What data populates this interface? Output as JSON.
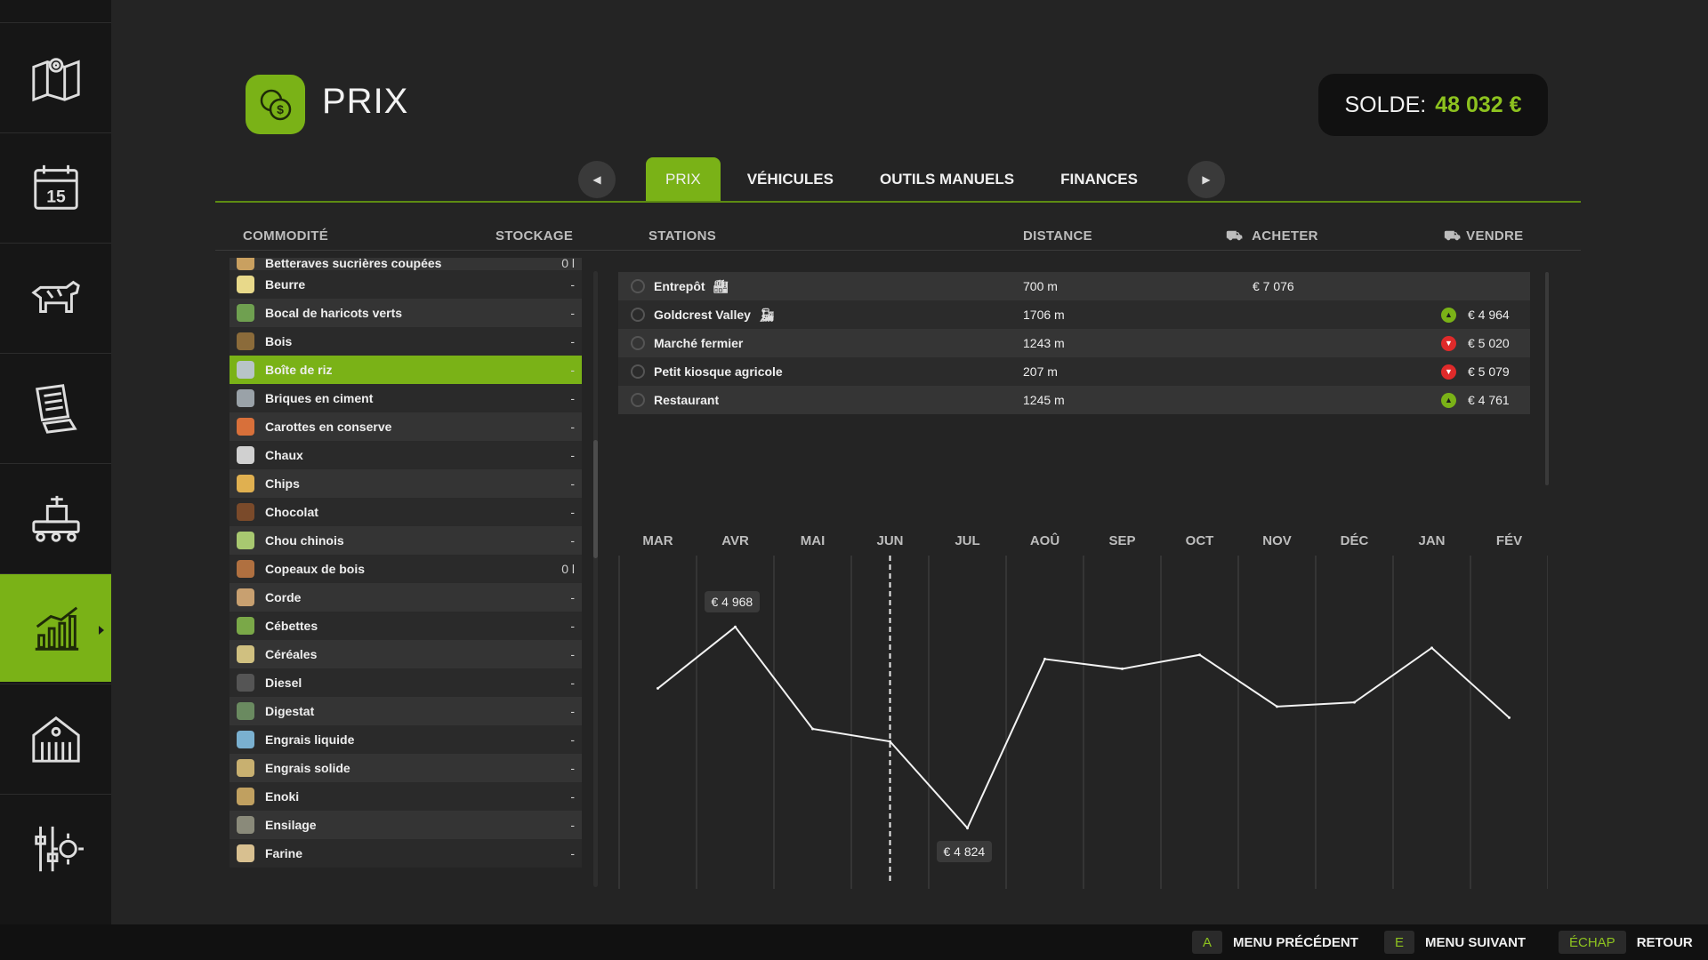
{
  "header": {
    "title": "PRIX",
    "balance_label": "SOLDE:",
    "balance_value": "48 032 €"
  },
  "sidebar": {
    "items": [
      {
        "name": "map-icon"
      },
      {
        "name": "calendar-icon",
        "day": "15"
      },
      {
        "name": "cow-icon"
      },
      {
        "name": "contracts-icon"
      },
      {
        "name": "production-icon"
      },
      {
        "name": "prices-chart-icon"
      },
      {
        "name": "barn-icon"
      },
      {
        "name": "settings-icon"
      }
    ]
  },
  "tabs": [
    "PRIX",
    "VÉHICULES",
    "OUTILS MANUELS",
    "FINANCES"
  ],
  "columns": {
    "commodity": "COMMODITÉ",
    "storage": "STOCKAGE",
    "stations": "STATIONS",
    "distance": "DISTANCE",
    "buy": "ACHETER",
    "sell": "VENDRE"
  },
  "commodities": [
    {
      "name": "Betteraves sucrières coupées",
      "stock": "0 l",
      "partial": true
    },
    {
      "name": "Beurre",
      "stock": "-"
    },
    {
      "name": "Bocal de haricots verts",
      "stock": "-"
    },
    {
      "name": "Bois",
      "stock": "-"
    },
    {
      "name": "Boîte de riz",
      "stock": "-",
      "selected": true
    },
    {
      "name": "Briques en ciment",
      "stock": "-"
    },
    {
      "name": "Carottes en conserve",
      "stock": "-"
    },
    {
      "name": "Chaux",
      "stock": "-"
    },
    {
      "name": "Chips",
      "stock": "-"
    },
    {
      "name": "Chocolat",
      "stock": "-"
    },
    {
      "name": "Chou chinois",
      "stock": "-"
    },
    {
      "name": "Copeaux de bois",
      "stock": "0 l"
    },
    {
      "name": "Corde",
      "stock": "-"
    },
    {
      "name": "Cébettes",
      "stock": "-"
    },
    {
      "name": "Céréales",
      "stock": "-"
    },
    {
      "name": "Diesel",
      "stock": "-"
    },
    {
      "name": "Digestat",
      "stock": "-"
    },
    {
      "name": "Engrais liquide",
      "stock": "-"
    },
    {
      "name": "Engrais solide",
      "stock": "-"
    },
    {
      "name": "Enoki",
      "stock": "-"
    },
    {
      "name": "Ensilage",
      "stock": "-"
    },
    {
      "name": "Farine",
      "stock": "-"
    }
  ],
  "stations": [
    {
      "name": "Entrepôt",
      "badge": "factory-icon",
      "distance": "700 m",
      "buy": "€ 7 076",
      "sell": "",
      "trend": ""
    },
    {
      "name": "Goldcrest Valley",
      "badge": "train-icon",
      "distance": "1706 m",
      "buy": "",
      "sell": "€ 4 964",
      "trend": "up"
    },
    {
      "name": "Marché fermier",
      "badge": "",
      "distance": "1243 m",
      "buy": "",
      "sell": "€ 5 020",
      "trend": "down"
    },
    {
      "name": "Petit kiosque agricole",
      "badge": "",
      "distance": "207 m",
      "buy": "",
      "sell": "€ 5 079",
      "trend": "down"
    },
    {
      "name": "Restaurant",
      "badge": "",
      "distance": "1245 m",
      "buy": "",
      "sell": "€ 4 761",
      "trend": "up"
    }
  ],
  "chart_data": {
    "type": "line",
    "categories": [
      "MAR",
      "AVR",
      "MAI",
      "JUN",
      "JUL",
      "AOÛ",
      "SEP",
      "OCT",
      "NOV",
      "DÉC",
      "JAN",
      "FÉV"
    ],
    "values": [
      4924,
      4968,
      4895,
      4886,
      4824,
      4945,
      4938,
      4948,
      4911,
      4914,
      4953,
      4903
    ],
    "current_month": "JUN",
    "ylim": [
      4790,
      5000
    ],
    "annotations": [
      {
        "label": "€ 4 968",
        "category": "AVR",
        "kind": "max"
      },
      {
        "label": "€ 4 824",
        "category": "JUL",
        "kind": "min"
      }
    ],
    "grid": true
  },
  "footer": {
    "prev_key": "A",
    "prev_label": "MENU PRÉCÉDENT",
    "next_key": "E",
    "next_label": "MENU SUIVANT",
    "back_key": "ÉCHAP",
    "back_label": "RETOUR"
  },
  "colors": {
    "accent": "#7ab217",
    "balance": "#8dc21f",
    "down": "#e02a2a",
    "background": "#242424"
  }
}
